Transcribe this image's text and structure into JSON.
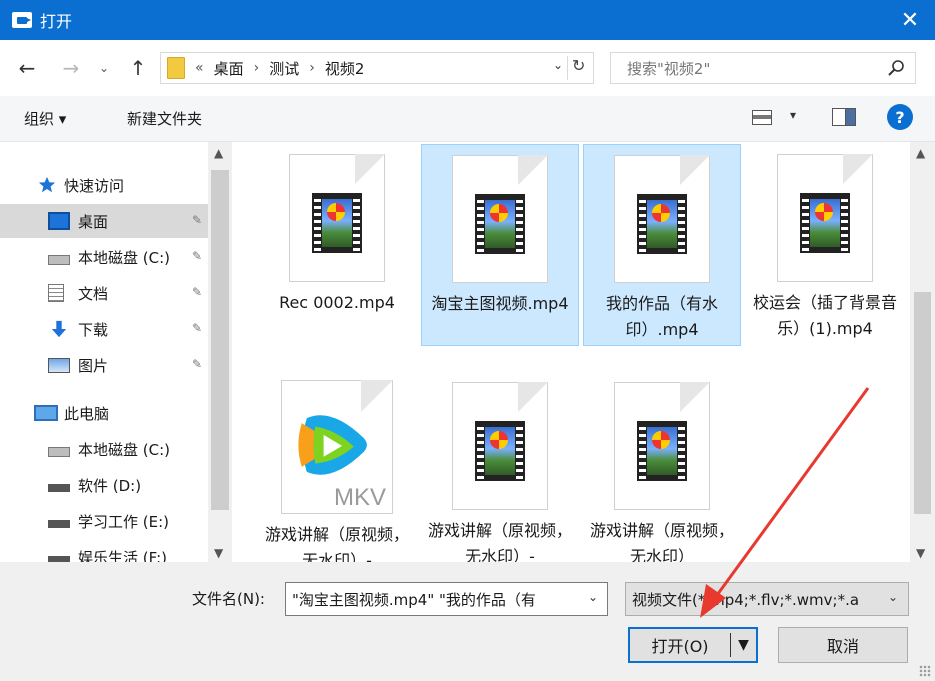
{
  "window": {
    "title": "打开",
    "close_glyph": "✕"
  },
  "nav": {
    "back": "←",
    "forward": "→",
    "recent": "⌄",
    "up": "↑",
    "breadcrumb_overflow": "«",
    "breadcrumbs": [
      "桌面",
      "测试",
      "视频2"
    ],
    "crumb_sep": "›",
    "path_dropdown": "⌄",
    "refresh": "↻",
    "search_placeholder": "搜索\"视频2\""
  },
  "toolbar": {
    "organize": "组织 ▾",
    "new_folder": "新建文件夹",
    "view_dropdown": "▾",
    "help": "?"
  },
  "sidebar": {
    "items": [
      {
        "label": "快速访问",
        "icon": "star-icon",
        "pinned": false,
        "selected": false
      },
      {
        "label": "桌面",
        "icon": "desktop-icon",
        "pinned": true,
        "selected": true
      },
      {
        "label": "本地磁盘 (C:)",
        "icon": "drive-icon",
        "pinned": true,
        "selected": false
      },
      {
        "label": "文档",
        "icon": "document-icon",
        "pinned": true,
        "selected": false
      },
      {
        "label": "下载",
        "icon": "download-icon",
        "pinned": true,
        "selected": false
      },
      {
        "label": "图片",
        "icon": "pictures-icon",
        "pinned": true,
        "selected": false
      },
      {
        "label": "此电脑",
        "icon": "computer-icon",
        "pinned": false,
        "selected": false
      },
      {
        "label": "本地磁盘 (C:)",
        "icon": "drive-icon",
        "pinned": false,
        "selected": false
      },
      {
        "label": "软件 (D:)",
        "icon": "drive-icon",
        "pinned": false,
        "selected": false
      },
      {
        "label": "学习工作 (E:)",
        "icon": "drive-icon",
        "pinned": false,
        "selected": false
      },
      {
        "label": "娱乐生活 (F:)",
        "icon": "drive-icon",
        "pinned": false,
        "selected": false
      }
    ],
    "pin_glyph": "📌"
  },
  "files": [
    {
      "name": "Rec 0002.mp4",
      "type": "video",
      "selected": false
    },
    {
      "name": "淘宝主图视频.mp4",
      "type": "video",
      "selected": true
    },
    {
      "name": "我的作品（有水印）.mp4",
      "type": "video",
      "selected": true
    },
    {
      "name": "校运会（插了背景音乐）(1).mp4",
      "type": "video",
      "selected": false
    },
    {
      "name": "游戏讲解（原视频，无水印）-",
      "type": "mkv",
      "badge": "MKV",
      "selected": false
    },
    {
      "name": "游戏讲解（原视频，无水印）-",
      "type": "video",
      "selected": false
    },
    {
      "name": "游戏讲解（原视频，无水印）",
      "type": "video",
      "selected": false
    }
  ],
  "bottom": {
    "filename_label": "文件名(N):",
    "filename_value": "\"淘宝主图视频.mp4\" \"我的作品（有",
    "filetype_value": "视频文件(*.mp4;*.flv;*.wmv;*.a",
    "dropdown": "⌄",
    "open_label": "打开(O)",
    "open_arrow": "▼",
    "cancel_label": "取消"
  },
  "colors": {
    "titlebar": "#0a6fd0",
    "selection": "#cce8ff",
    "annotation": "#e8392f"
  }
}
